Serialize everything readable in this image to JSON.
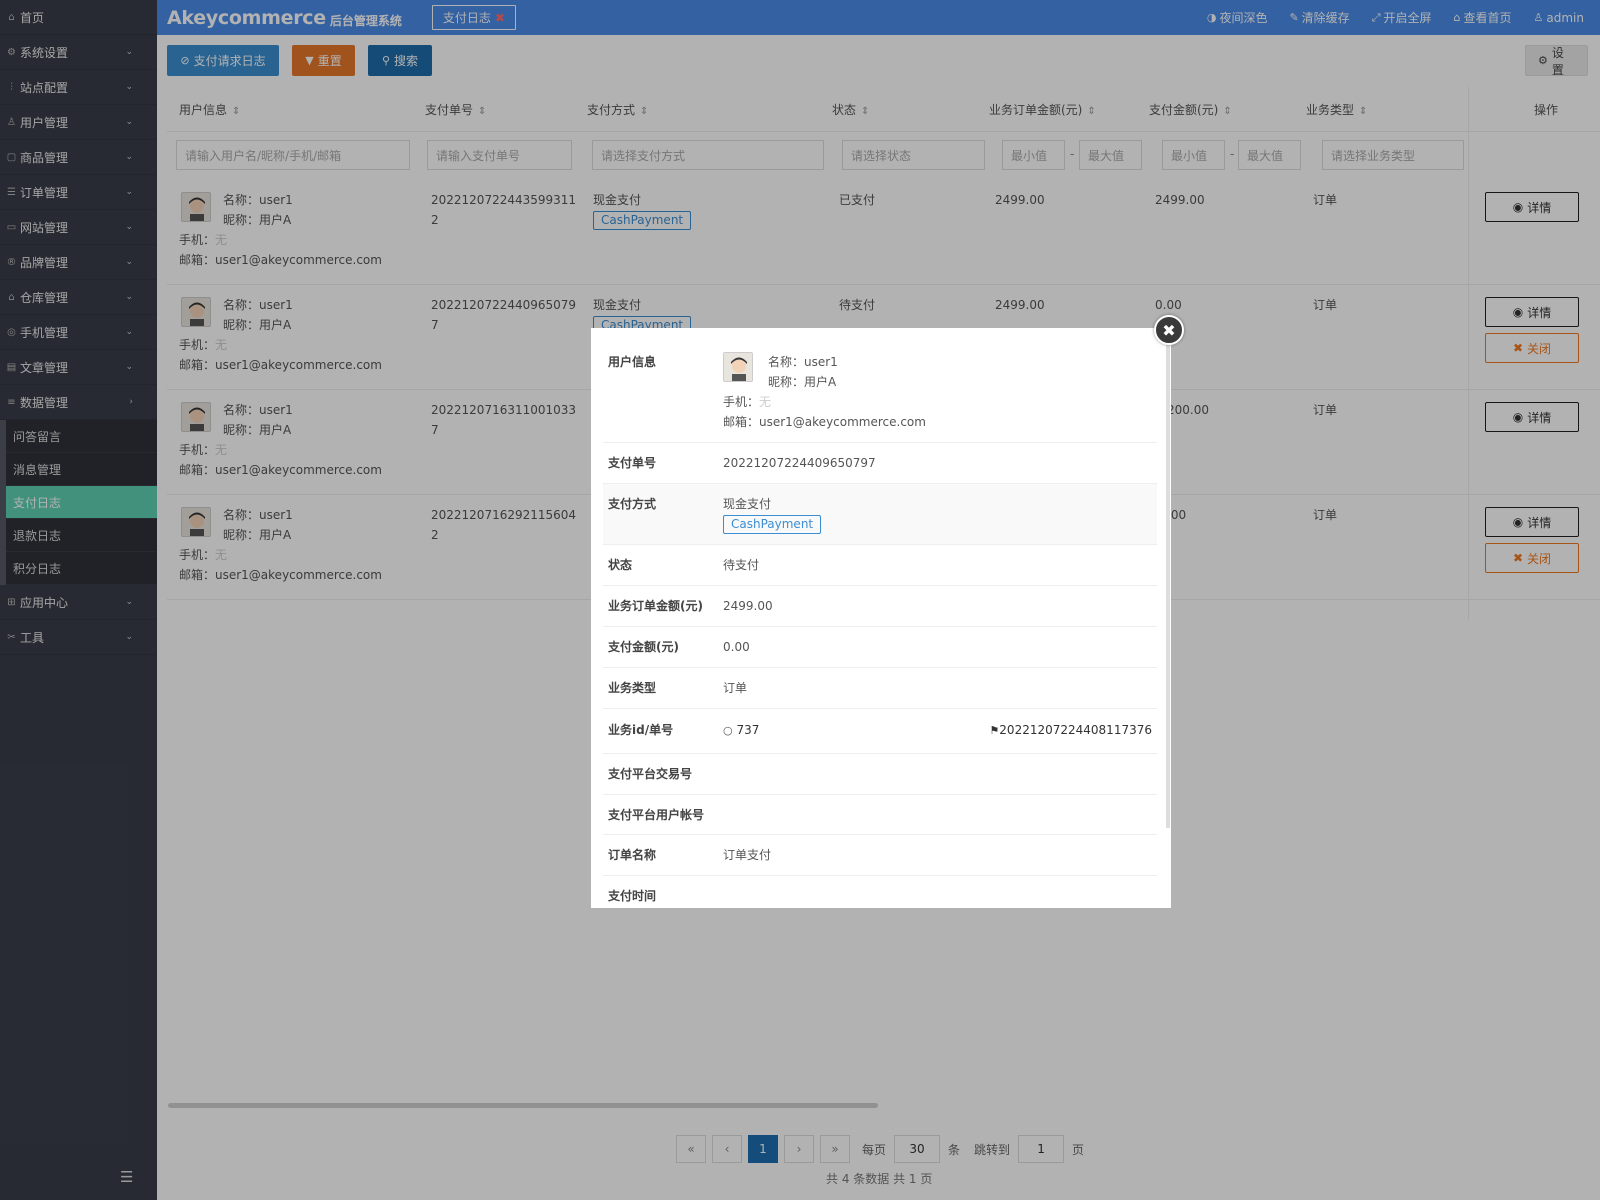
{
  "header": {
    "brand": "Akeycommerce",
    "brand_sub": "后台管理系统",
    "tab_label": "支付日志",
    "links": [
      "夜间深色",
      "清除缓存",
      "开启全屏",
      "查看首页",
      "admin"
    ]
  },
  "sidebar": {
    "items": [
      "首页",
      "系统设置",
      "站点配置",
      "用户管理",
      "商品管理",
      "订单管理",
      "网站管理",
      "品牌管理",
      "仓库管理",
      "手机管理",
      "文章管理",
      "数据管理"
    ],
    "sub_items": [
      "问答留言",
      "消息管理",
      "支付日志",
      "退款日志",
      "积分日志"
    ],
    "items_after": [
      "应用中心",
      "工具"
    ]
  },
  "toolbar": {
    "btn_log": "支付请求日志",
    "btn_reset": "重置",
    "btn_search": "搜索",
    "btn_settings": "设置"
  },
  "table": {
    "headers": [
      "用户信息",
      "支付单号",
      "支付方式",
      "状态",
      "业务订单金额(元)",
      "支付金额(元)",
      "业务类型",
      "操作"
    ],
    "filters": {
      "user": "请输入用户名/昵称/手机/邮箱",
      "payno": "请输入支付单号",
      "method": "请选择支付方式",
      "status": "请选择状态",
      "min": "最小值",
      "max": "最大值",
      "biz": "请选择业务类型"
    },
    "rows": [
      {
        "name": "名称：user1",
        "nick": "昵称：用户A",
        "phone_label": "手机：",
        "phone": "无",
        "email": "邮箱：user1@akeycommerce.com",
        "payno_1": "2022120722443599311",
        "payno_2": "2",
        "method": "现金支付",
        "method_tag": "CashPayment",
        "status": "已支付",
        "order_amt": "2499.00",
        "pay_amt": "2499.00",
        "biz": "订单",
        "btn_detail": "详情",
        "btn_close": ""
      },
      {
        "name": "名称：user1",
        "nick": "昵称：用户A",
        "phone_label": "手机：",
        "phone": "无",
        "email": "邮箱：user1@akeycommerce.com",
        "payno_1": "2022120722440965079",
        "payno_2": "7",
        "method": "现金支付",
        "method_tag": "CashPayment",
        "status": "待支付",
        "order_amt": "2499.00",
        "pay_amt": "0.00",
        "biz": "订单",
        "btn_detail": "详情",
        "btn_close": "关闭"
      },
      {
        "name": "名称：user1",
        "nick": "昵称：用户A",
        "phone_label": "手机：",
        "phone": "无",
        "email": "邮箱：user1@akeycommerce.com",
        "payno_1": "2022120716311001033",
        "payno_2": "7",
        "method": "",
        "method_tag": "",
        "status": "",
        "order_amt": "",
        "pay_amt": "200.00",
        "biz": "订单",
        "btn_detail": "详情",
        "btn_close": ""
      },
      {
        "name": "名称：user1",
        "nick": "昵称：用户A",
        "phone_label": "手机：",
        "phone": "无",
        "email": "邮箱：user1@akeycommerce.com",
        "payno_1": "2022120716292115604",
        "payno_2": "2",
        "method": "",
        "method_tag": "",
        "status": "",
        "order_amt": "",
        "pay_amt": ".00",
        "biz": "订单",
        "btn_detail": "详情",
        "btn_close": "关闭"
      }
    ]
  },
  "pagination": {
    "first": "«",
    "prev": "‹",
    "current": "1",
    "next": "›",
    "last": "»",
    "per_page_label": "每页",
    "per_page": "30",
    "per_page_unit": "条",
    "jump_label": "跳转到",
    "jump_page": "1",
    "jump_unit": "页",
    "summary": "共 4 条数据    共 1 页"
  },
  "modal": {
    "user_label": "用户信息",
    "user_name": "名称：user1",
    "user_nick": "昵称：用户A",
    "user_phone_label": "手机：",
    "user_phone": "无",
    "user_email": "邮箱：user1@akeycommerce.com",
    "payno_label": "支付单号",
    "payno": "20221207224409650797",
    "method_label": "支付方式",
    "method": "现金支付",
    "method_tag": "CashPayment",
    "status_label": "状态",
    "status": "待支付",
    "order_amt_label": "业务订单金额(元)",
    "order_amt": "2499.00",
    "pay_amt_label": "支付金额(元)",
    "pay_amt": "0.00",
    "biz_label": "业务类型",
    "biz": "订单",
    "bizid_label": "业务id/单号",
    "bizid": "737",
    "bizno": "20221207224408117376",
    "trade_label": "支付平台交易号",
    "acct_label": "支付平台用户帐号",
    "order_name_label": "订单名称",
    "order_name": "订单支付",
    "pay_time_label": "支付时间"
  }
}
